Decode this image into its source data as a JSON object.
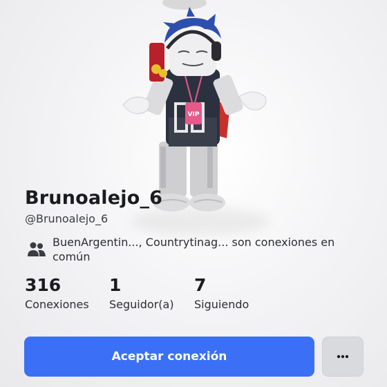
{
  "profile": {
    "display_name": "Brunoalejo_6",
    "username": "@Brunoalejo_6",
    "mutual_connections_text": "BuenArgentin..., Countrytinag... son conexiones en común"
  },
  "stats": [
    {
      "value": "316",
      "label": "Conexiones"
    },
    {
      "value": "1",
      "label": "Seguidor(a)"
    },
    {
      "value": "7",
      "label": "Siguiendo"
    }
  ],
  "actions": {
    "primary_label": "Aceptar conexión",
    "more_icon": "ellipsis-icon"
  },
  "colors": {
    "primary": "#3b6ff5",
    "secondary_button": "#d9dade",
    "text": "#1a1b1f"
  }
}
